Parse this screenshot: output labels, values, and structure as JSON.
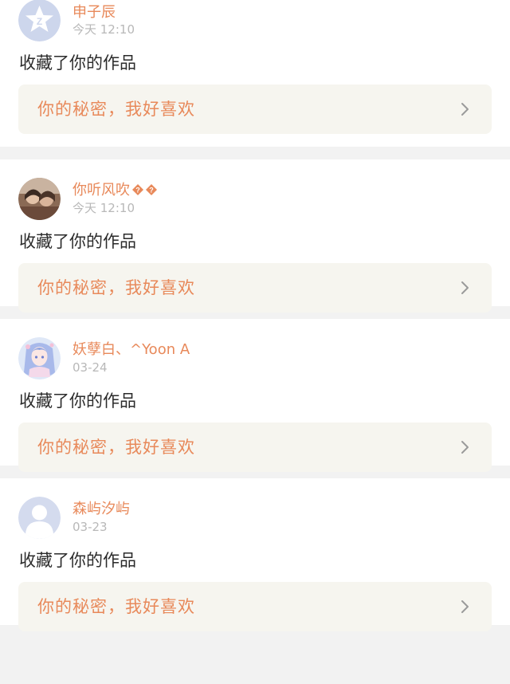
{
  "notifications": [
    {
      "avatar_icon": "qzone-star-icon",
      "user_name": "申子辰",
      "time": "今天 12:10",
      "action": "收藏了你的作品",
      "work_title": "你的秘密，我好喜欢"
    },
    {
      "avatar_icon": "photo-avatar",
      "user_name": "你听风吹",
      "name_suffix_icons": [
        "unknown-glyph-icon",
        "unknown-glyph-icon"
      ],
      "time": "今天 12:10",
      "action": "收藏了你的作品",
      "work_title": "你的秘密，我好喜欢"
    },
    {
      "avatar_icon": "anime-girl-avatar",
      "user_name": "妖孽白、^Yoon A",
      "time": "03-24",
      "action": "收藏了你的作品",
      "work_title": "你的秘密，我好喜欢"
    },
    {
      "avatar_icon": "default-user-avatar",
      "user_name": "森屿汐屿",
      "time": "03-23",
      "action": "收藏了你的作品",
      "work_title": "你的秘密，我好喜欢"
    }
  ],
  "colors": {
    "accent": "#e8895a",
    "time_gray": "#b8b8b8",
    "text_dark": "#2b2b2b",
    "work_box_bg": "#f6f5ef",
    "separator": "#f2f2f2"
  }
}
